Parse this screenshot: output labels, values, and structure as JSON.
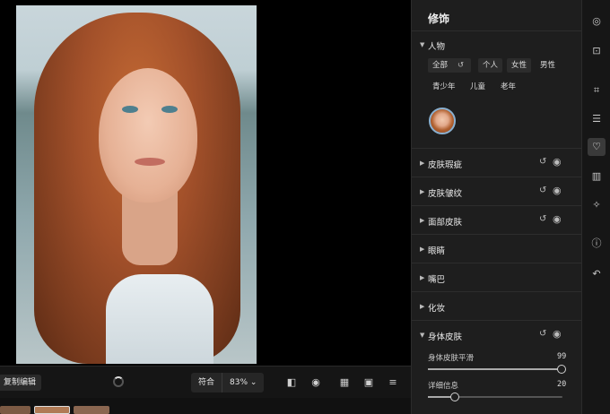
{
  "panel": {
    "title": "修饰",
    "person_section": "人物",
    "chips": {
      "all": "全部",
      "personal": "个人",
      "female": "女性",
      "male": "男性",
      "teen": "青少年",
      "child": "儿童",
      "elder": "老年"
    },
    "sections": [
      {
        "label": "皮肤瑕疵"
      },
      {
        "label": "皮肤皱纹"
      },
      {
        "label": "面部皮肤"
      },
      {
        "label": "眼睛"
      },
      {
        "label": "嘴巴"
      },
      {
        "label": "化妆"
      },
      {
        "label": "身体皮肤"
      }
    ],
    "sliders": [
      {
        "label": "身体皮肤平滑",
        "value": "99",
        "fraction": 0.99
      },
      {
        "label": "详细信息",
        "value": "20",
        "fraction": 0.2
      }
    ]
  },
  "toolbar": {
    "copy_edit": "复制编辑",
    "fit": "符合",
    "zoom": "83% ⌄"
  },
  "icons": {
    "reset": "↺",
    "visibility": "◉",
    "caret_down": "▼",
    "caret_right": "▶"
  }
}
